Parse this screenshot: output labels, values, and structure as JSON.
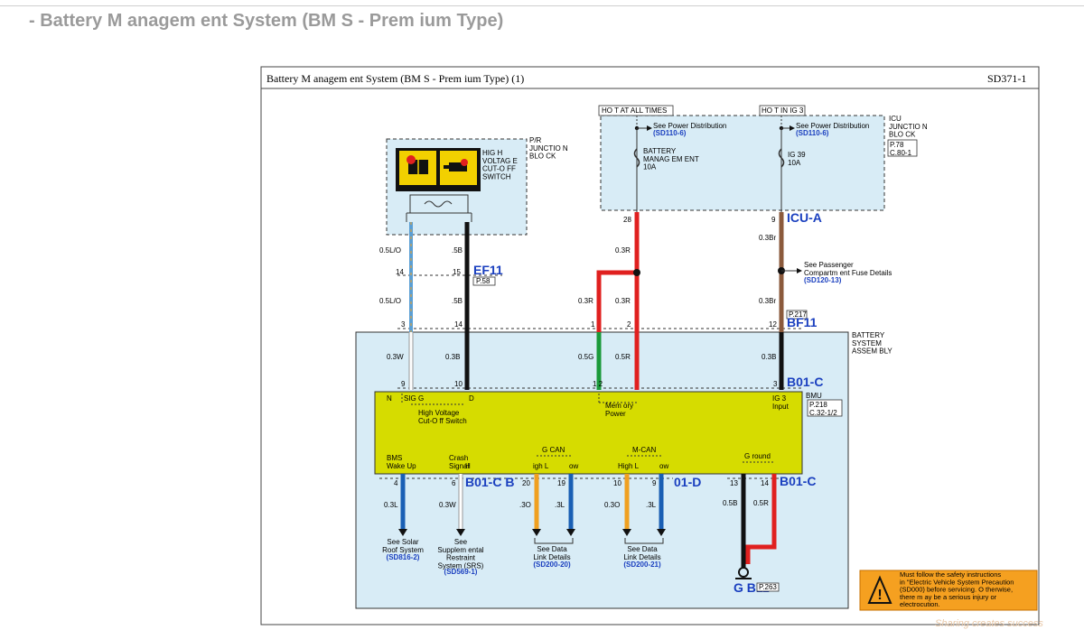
{
  "page": {
    "title": "- Battery M anagem ent System (BM S - Prem ium Type)"
  },
  "sheet": {
    "title": "Battery M anagem ent System (BM S - Prem ium Type) (1)",
    "code": "SD371-1"
  },
  "pr_block": {
    "name": "P/R\nJUNCTIO N\nBLO CK",
    "switch": "HIG H\nVOLTAG E\nCUT-O FF\nSWITCH"
  },
  "icu_block": {
    "name": "ICU\nJUNCTIO N\nBLO CK",
    "page_ref": "P.78\nC.80-1",
    "hot_at_all_times": "HO T AT ALL TIMES",
    "hot_in_ig3": "HO T IN IG 3",
    "see_power_dist": "See Power Distribution",
    "ref1": "(SD110-6)",
    "ref2": "(SD110-6)",
    "fuse1": "BATTERY\nMANAG EM ENT\n10A",
    "fuse2": "IG 39\n10A",
    "pin28": "28",
    "pin9": "9",
    "connector": "ICU-A"
  },
  "ef11": {
    "name": "EF11",
    "ref": "P.58",
    "pin14": "14",
    "pin15": "15"
  },
  "bf11": {
    "name": "BF11",
    "ref": "P.217",
    "pin3": "3",
    "pin14": "14",
    "pin1": "1",
    "pin2": "2",
    "pin12": "12"
  },
  "wires": {
    "w1a": "0.5L/O",
    "w1b": "0.5L/O",
    "w2a": ".5B",
    "w2b": ".5B",
    "w3a": "0.3R",
    "w3b": "0.3R",
    "w3c": "0.3R",
    "w4a": "0.3Br",
    "w4b": "0.3Br",
    "w5": "0.3W",
    "w6": "0.3B",
    "w7": "0.5G",
    "w8": "0.5R",
    "w9": "0.3B",
    "w10": "0.3L",
    "w11": "0.3W",
    "w12": ".3O",
    "w13": ".3L",
    "w14": "0.3O",
    "w15": ".3L",
    "w16": "0.5B",
    "w17": "0.5R"
  },
  "fuse_details": {
    "label": "See Passenger\nCompartm ent Fuse Details",
    "ref": "(SD120-13)"
  },
  "assembly": {
    "name": "BATTERY\nSYSTEM\nASSEM BLY"
  },
  "b01c_top": {
    "name": "B01-C",
    "pin9": "9",
    "pin10": "10",
    "pin12": "1 2",
    "pin3": "3"
  },
  "bmu": {
    "name": "BMU",
    "ref": "P.218\nC.32-1/2",
    "n": "N",
    "sigg": "SIG G",
    "d": "D",
    "hv_cutoff": "High Voltage\nCut-O ff Switch",
    "memory_power": "Mem ory\nPower",
    "ig3_input": "IG 3\nInput",
    "wake_up": "BMS\nWake Up",
    "crash": "Crash\nSignal",
    "h": "H",
    "gcan": "G CAN",
    "gcan_high": "igh L",
    "gcan_low": "ow",
    "mcan": "M-CAN",
    "mcan_high": "High L",
    "mcan_low": "ow",
    "ground": "G round"
  },
  "bottom_connectors": {
    "b01cb": "B01-C B",
    "d01": "01-D",
    "b01c": "B01-C",
    "pin4": "4",
    "pin6": "6",
    "pin20": "20",
    "pin19": "19",
    "pin10": "10",
    "pin9": "9",
    "pin13": "13",
    "pin14": "14"
  },
  "destinations": {
    "solar": "See Solar\nRoof System",
    "solar_ref": "(SD816-2)",
    "srs": "See\nSupplem ental\nRestraint\nSystem (SRS)",
    "srs_ref": "(SD569-1)",
    "data1": "See Data\nLink Details",
    "data1_ref": "(SD200-20)",
    "data2": "See Data\nLink Details",
    "data2_ref": "(SD200-21)"
  },
  "ground": {
    "name": "G B11",
    "ref": "P.263"
  },
  "warning": {
    "text": "Must follow the safety instructions\nin \"Electric Vehicle System Precaution\n(SD000) before servicing. O therwise,\nthere m ay be a serious injury or\nelectrocution."
  },
  "watermark": {
    "text": "Sharing creates success"
  },
  "colors": {
    "wire_blue": "#1a5fb4",
    "wire_red": "#e0201f",
    "wire_brown": "#8b5a3c",
    "wire_green": "#1a9a3a",
    "wire_orange": "#f0a020",
    "bmu_fill": "#d6dc00",
    "block_fill": "#d8ecf6",
    "warning_fill": "#f5a020"
  }
}
